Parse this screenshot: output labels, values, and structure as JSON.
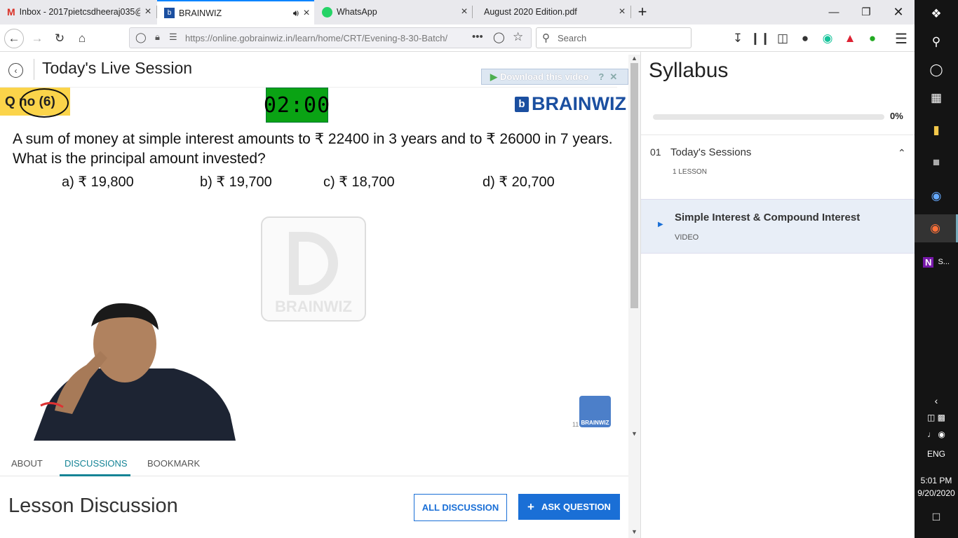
{
  "tabs": [
    {
      "icon": "gmail-icon",
      "label": "Inbox - 2017pietcsdheeraj035@"
    },
    {
      "icon": "brainwiz-icon",
      "label": "BRAINWIZ"
    },
    {
      "icon": "whatsapp-icon",
      "label": "WhatsApp"
    },
    {
      "icon": "pdf-icon",
      "label": "August 2020 Edition.pdf"
    }
  ],
  "nav": {
    "url": "https://online.gobrainwiz.in/learn/home/CRT/Evening-8-30-Batch/",
    "search_placeholder": "Search"
  },
  "session": {
    "title": "Today's Live Session",
    "download_label": "Download this video",
    "qno": "Q no (6)",
    "timer": "02:00",
    "brand": "BRAINWIZ",
    "question": "A sum of money at simple interest amounts to ₹ 22400 in 3 years and to ₹ 26000 in 7 years. What is the principal amount invested?",
    "options": [
      "a) ₹ 19,800",
      "b) ₹ 19,700",
      "c) ₹ 18,700",
      "d) ₹ 20,700"
    ],
    "watermark": "BRAINWIZ",
    "small_logo": "BRAINWIZ",
    "slide_num": "11"
  },
  "lesson_tabs": [
    "ABOUT",
    "DISCUSSIONS",
    "BOOKMARK"
  ],
  "discussion": {
    "title": "Lesson Discussion",
    "all_label": "ALL DISCUSSION",
    "ask_label": "ASK QUESTION"
  },
  "syllabus": {
    "title": "Syllabus",
    "progress_label": "0%",
    "progress": 0,
    "section": {
      "num": "01",
      "name": "Today's Sessions",
      "count": "1 LESSON"
    },
    "lesson": {
      "title": "Simple Interest & Compound Interest",
      "type": "VIDEO"
    }
  },
  "taskbar": {
    "onenote_label": "S...",
    "time": "5:01 PM",
    "date": "9/20/2020",
    "lang": "ENG"
  },
  "colors": {
    "accent": "#1a6fd6",
    "teal": "#158496",
    "timer": "#0aa314",
    "qno": "#fbd44a"
  }
}
